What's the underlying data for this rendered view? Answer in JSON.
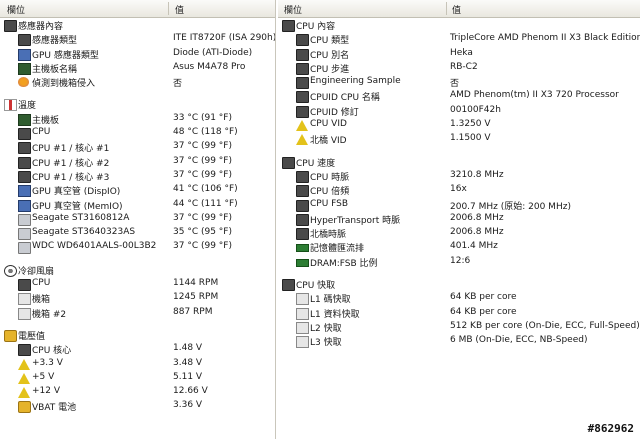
{
  "left_panel": {
    "header": {
      "field": "欄位",
      "value": "值"
    },
    "sections": [
      {
        "title": "感應器內容",
        "icon": "sensor-chip-icon",
        "items": [
          {
            "icon": "chip-icon",
            "label": "感應器類型",
            "value": "ITE IT8720F  (ISA 290h)"
          },
          {
            "icon": "gpu-chip-icon",
            "label": "GPU 感應器類型",
            "value": "Diode  (ATI-Diode)"
          },
          {
            "icon": "motherboard-icon",
            "label": "主機板名稱",
            "value": "Asus M4A78 Pro"
          },
          {
            "icon": "intrusion-icon",
            "label": "偵測到機箱侵入",
            "value": "否"
          }
        ]
      },
      {
        "title": "溫度",
        "icon": "thermometer-icon",
        "items": [
          {
            "icon": "motherboard-icon",
            "label": "主機板",
            "value": "33 °C  (91 °F)"
          },
          {
            "icon": "cpu-chip-icon",
            "label": "CPU",
            "value": "48 °C  (118 °F)"
          },
          {
            "icon": "cpu-chip-icon",
            "label": "CPU #1 / 核心 #1",
            "value": "37 °C  (99 °F)"
          },
          {
            "icon": "cpu-chip-icon",
            "label": "CPU #1 / 核心 #2",
            "value": "37 °C  (99 °F)"
          },
          {
            "icon": "cpu-chip-icon",
            "label": "CPU #1 / 核心 #3",
            "value": "37 °C  (99 °F)"
          },
          {
            "icon": "gpu-icon",
            "label": "GPU 真空管 (DispIO)",
            "value": "41 °C  (106 °F)"
          },
          {
            "icon": "gpu-icon",
            "label": "GPU 真空管 (MemIO)",
            "value": "44 °C  (111 °F)"
          },
          {
            "icon": "hard-drive-icon",
            "label": "Seagate ST3160812A",
            "value": "37 °C  (99 °F)"
          },
          {
            "icon": "hard-drive-icon",
            "label": "Seagate ST3640323AS",
            "value": "35 °C  (95 °F)"
          },
          {
            "icon": "hard-drive-icon",
            "label": "WDC WD6401AALS-00L3B2",
            "value": "37 °C  (99 °F)"
          }
        ]
      },
      {
        "title": "冷卻風扇",
        "icon": "fan-icon",
        "items": [
          {
            "icon": "cpu-chip-icon",
            "label": "CPU",
            "value": "1144 RPM"
          },
          {
            "icon": "case-icon",
            "label": "機箱",
            "value": "1245 RPM"
          },
          {
            "icon": "case-icon",
            "label": "機箱 #2",
            "value": "887 RPM"
          }
        ]
      },
      {
        "title": "電壓值",
        "icon": "voltage-icon",
        "items": [
          {
            "icon": "cpu-chip-icon",
            "label": "CPU 核心",
            "value": "1.48 V"
          },
          {
            "icon": "voltage-warning-icon",
            "label": "+3.3 V",
            "value": "3.48 V"
          },
          {
            "icon": "voltage-warning-icon",
            "label": "+5 V",
            "value": "5.11 V"
          },
          {
            "icon": "voltage-warning-icon",
            "label": "+12 V",
            "value": "12.66 V"
          },
          {
            "icon": "battery-icon",
            "label": "VBAT 電池",
            "value": "3.36 V"
          }
        ]
      }
    ]
  },
  "right_panel": {
    "header": {
      "field": "欄位",
      "value": "值"
    },
    "sections": [
      {
        "title": "CPU 內容",
        "icon": "cpu-chip-icon",
        "items": [
          {
            "icon": "cpu-chip-icon",
            "label": "CPU 類型",
            "value": "TripleCore AMD Phenom II X3 Black Edition 720"
          },
          {
            "icon": "cpu-chip-icon",
            "label": "CPU 別名",
            "value": "Heka"
          },
          {
            "icon": "cpu-chip-icon",
            "label": "CPU 步進",
            "value": "RB-C2"
          },
          {
            "icon": "cpu-chip-icon",
            "label": "Engineering Sample",
            "value": "否"
          },
          {
            "icon": "cpu-chip-icon",
            "label": "CPUID CPU 名稱",
            "value": "AMD Phenom(tm) II X3 720 Processor"
          },
          {
            "icon": "cpu-chip-icon",
            "label": "CPUID 修訂",
            "value": "00100F42h"
          },
          {
            "icon": "voltage-warning-icon",
            "label": "CPU VID",
            "value": "1.3250 V"
          },
          {
            "icon": "voltage-warning-icon",
            "label": "北橋 VID",
            "value": "1.1500 V"
          }
        ]
      },
      {
        "title": "CPU 速度",
        "icon": "cpu-chip-icon",
        "items": [
          {
            "icon": "cpu-chip-icon",
            "label": "CPU 時脈",
            "value": "3210.8 MHz"
          },
          {
            "icon": "cpu-chip-icon",
            "label": "CPU 倍頻",
            "value": "16x"
          },
          {
            "icon": "cpu-chip-icon",
            "label": "CPU FSB",
            "value": "200.7 MHz  (原始: 200 MHz)"
          },
          {
            "icon": "cpu-chip-icon",
            "label": "HyperTransport 時脈",
            "value": "2006.8 MHz"
          },
          {
            "icon": "chip-icon",
            "label": "北橋時脈",
            "value": "2006.8 MHz"
          },
          {
            "icon": "memory-icon",
            "label": "記憶體匯流排",
            "value": "401.4 MHz"
          },
          {
            "icon": "memory-icon",
            "label": "DRAM:FSB 比例",
            "value": "12:6"
          }
        ]
      },
      {
        "title": "CPU 快取",
        "icon": "cpu-chip-icon",
        "items": [
          {
            "icon": "cache-icon",
            "label": "L1 碼快取",
            "value": "64 KB per core"
          },
          {
            "icon": "cache-icon",
            "label": "L1 資料快取",
            "value": "64 KB per core"
          },
          {
            "icon": "cache-icon",
            "label": "L2 快取",
            "value": "512 KB per core  (On-Die, ECC, Full-Speed)"
          },
          {
            "icon": "cache-icon",
            "label": "L3 快取",
            "value": "6 MB  (On-Die, ECC, NB-Speed)"
          }
        ]
      }
    ]
  },
  "watermark": "#862962"
}
